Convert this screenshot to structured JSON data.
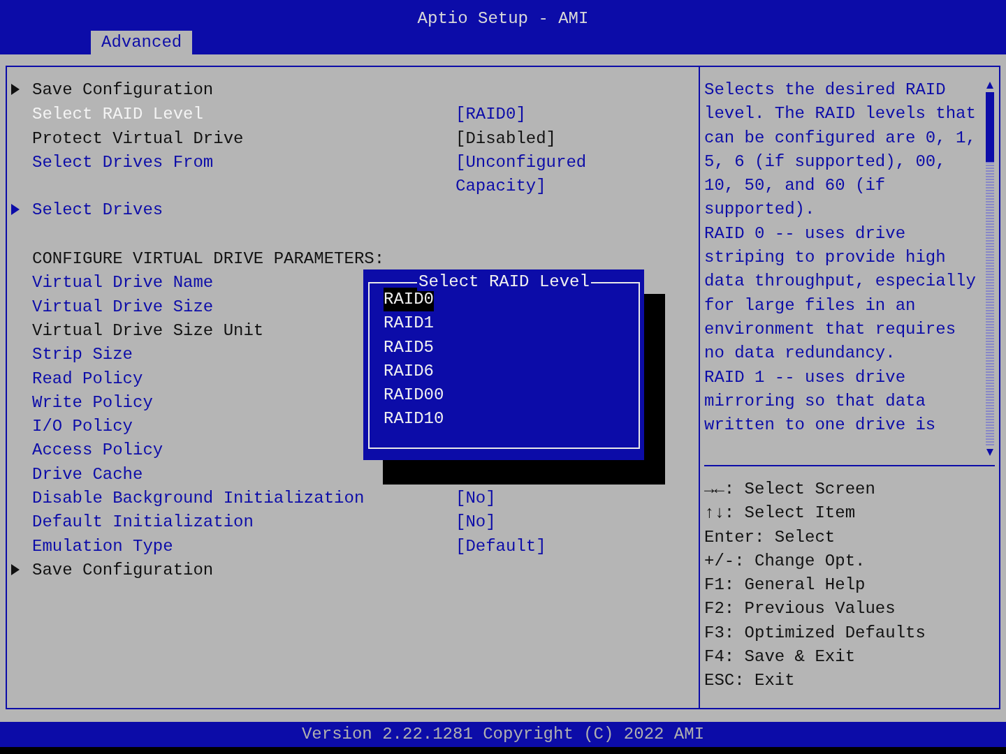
{
  "window": {
    "title": "Aptio Setup - AMI"
  },
  "tabs": [
    {
      "label": "Advanced",
      "selected": true
    }
  ],
  "menu": [
    {
      "kind": "submenu",
      "label": "Save Configuration",
      "editable": false,
      "selected": false
    },
    {
      "kind": "setting",
      "label": "Select RAID Level",
      "value": "[RAID0]",
      "editable": true,
      "selected": true
    },
    {
      "kind": "setting",
      "label": "Protect Virtual Drive",
      "value": "[Disabled]",
      "editable": false,
      "selected": false
    },
    {
      "kind": "setting",
      "label": "Select Drives From",
      "value": "[Unconfigured Capacity]",
      "editable": true,
      "selected": false
    },
    {
      "kind": "submenu",
      "label": "Select Drives",
      "editable": true,
      "selected": false
    },
    {
      "kind": "blank"
    },
    {
      "kind": "setting",
      "label": "CONFIGURE VIRTUAL DRIVE PARAMETERS:",
      "editable": false,
      "selected": false
    },
    {
      "kind": "setting",
      "label": "Virtual Drive Name",
      "editable": true,
      "selected": false
    },
    {
      "kind": "setting",
      "label": "Virtual Drive Size",
      "editable": true,
      "selected": false
    },
    {
      "kind": "setting",
      "label": "Virtual Drive Size Unit",
      "editable": false,
      "selected": false
    },
    {
      "kind": "setting",
      "label": "Strip Size",
      "editable": true,
      "selected": false
    },
    {
      "kind": "setting",
      "label": "Read Policy",
      "editable": true,
      "selected": false
    },
    {
      "kind": "setting",
      "label": "Write Policy",
      "editable": true,
      "selected": false
    },
    {
      "kind": "setting",
      "label": "I/O Policy",
      "editable": true,
      "selected": false
    },
    {
      "kind": "setting",
      "label": "Access Policy",
      "editable": true,
      "selected": false
    },
    {
      "kind": "setting",
      "label": "Drive Cache",
      "editable": true,
      "selected": false
    },
    {
      "kind": "setting",
      "label": "Disable Background Initialization",
      "value": "[No]",
      "editable": true,
      "selected": false
    },
    {
      "kind": "setting",
      "label": "Default Initialization",
      "value": "[No]",
      "editable": true,
      "selected": false
    },
    {
      "kind": "setting",
      "label": "Emulation Type",
      "value": "[Default]",
      "editable": true,
      "selected": false
    },
    {
      "kind": "submenu",
      "label": "Save Configuration",
      "editable": false,
      "selected": false
    }
  ],
  "popup": {
    "title": "Select RAID Level",
    "options": [
      {
        "label": "RAID0",
        "selected": true
      },
      {
        "label": "RAID1",
        "selected": false
      },
      {
        "label": "RAID5",
        "selected": false
      },
      {
        "label": "RAID6",
        "selected": false
      },
      {
        "label": "RAID00",
        "selected": false
      },
      {
        "label": "RAID10",
        "selected": false
      }
    ]
  },
  "help": [
    "Selects the desired RAID level. The RAID levels that can be configured are 0, 1, 5, 6 (if supported), 00, 10, 50, and 60 (if supported).",
    "RAID 0 -- uses drive striping to provide high data throughput, especially for large files in an environment that requires no data redundancy.",
    "RAID 1 -- uses drive mirroring so that data written to one drive is"
  ],
  "keys": [
    "→←: Select Screen",
    "↑↓: Select Item",
    "Enter: Select",
    "+/-: Change Opt.",
    "F1: General Help",
    "F2: Previous Values",
    "F3: Optimized Defaults",
    "F4: Save & Exit",
    "ESC: Exit"
  ],
  "status_bar": "Version 2.22.1281 Copyright (C) 2022 AMI"
}
